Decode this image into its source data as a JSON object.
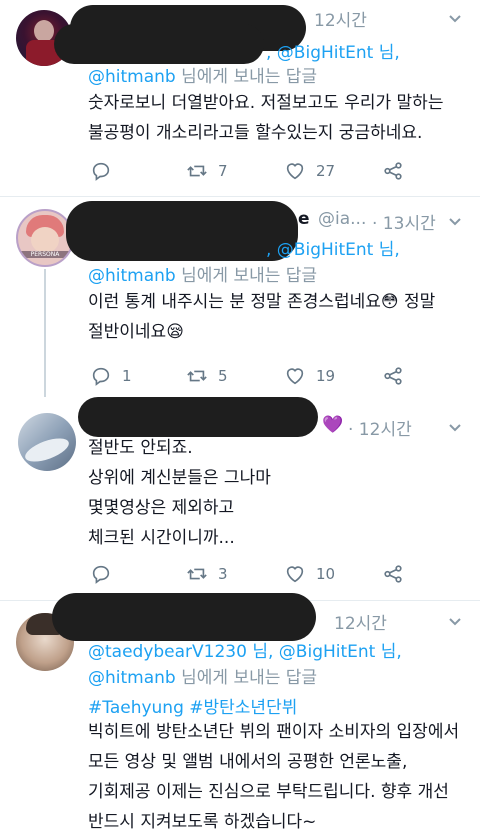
{
  "tweets": [
    {
      "time": "12시간",
      "reply_mentions": ", @BigHitEnt 님,",
      "reply_line2_handle": "@hitmanb",
      "reply_line2_rest": " 님에게 보내는 답글",
      "body": [
        "숫자로보니 더열받아요. 저절보고도 우리가 말하는",
        "불공평이 개소리라고들 할수있는지 궁금하네요."
      ],
      "counts": {
        "reply": "",
        "retweet": "7",
        "like": "27"
      }
    },
    {
      "name_tail": "e",
      "handle": "@ia...",
      "time": "· 13시간",
      "reply_mentions": ", @BigHitEnt 님,",
      "reply_line2_handle": "@hitmanb",
      "reply_line2_rest": " 님에게 보내는 답글",
      "body": [
        "이런 통계 내주시는 분 정말 존경스럽네요😳 정말",
        "절반이네요😪"
      ],
      "avatar_label": "PERSONA",
      "counts": {
        "reply": "1",
        "retweet": "5",
        "like": "19"
      }
    },
    {
      "time": "· 12시간",
      "name_emoji": "💜",
      "body": [
        "절반도 안되죠.",
        "상위에 계신분들은 그나마",
        "몇몇영상은 제외하고",
        "체크된 시간이니까..."
      ],
      "counts": {
        "reply": "",
        "retweet": "3",
        "like": "10"
      }
    },
    {
      "time": "12시간",
      "reply_line1_handle": "@taedybearV1230",
      "reply_line1_rest": " 님, @BigHitEnt 님,",
      "reply_line2_handle": "@hitmanb",
      "reply_line2_rest": " 님에게 보내는 답글",
      "hashtags": "#Taehyung #방탄소년단뷔",
      "body": [
        "빅히트에 방탄소년단 뷔의 팬이자 소비자의 입장에서",
        "모든 영상 및 앨범 내에서의 공평한 언론노출,",
        "기회제공 이제는 진심으로 부탁드립니다. 향후 개선",
        "반드시 지켜보도록 하겠습니다~"
      ]
    }
  ],
  "colors": {
    "link": "#1da1f2",
    "muted": "#8899a6",
    "redaction": "#1e1e1e"
  }
}
